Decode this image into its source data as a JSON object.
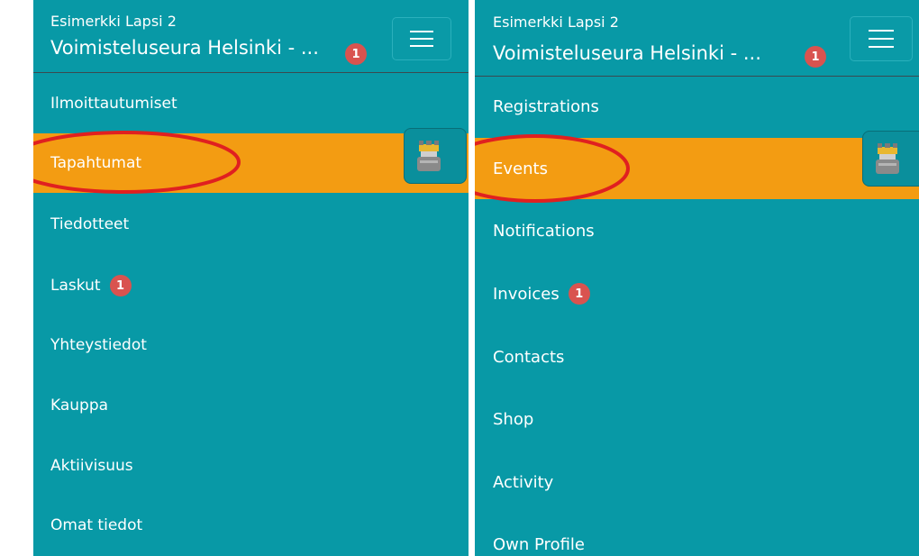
{
  "left": {
    "child_name": "Esimerkki Lapsi 2",
    "club_name": "Voimisteluseura Helsinki - ...",
    "header_badge": "1",
    "menu": [
      {
        "label": "Ilmoittautumiset"
      },
      {
        "label": "Tapahtumat",
        "active": true
      },
      {
        "label": "Tiedotteet"
      },
      {
        "label": "Laskut",
        "badge": "1"
      },
      {
        "label": "Yhteystiedot"
      },
      {
        "label": "Kauppa"
      },
      {
        "label": "Aktiivisuus"
      },
      {
        "label": "Omat tiedot"
      }
    ]
  },
  "right": {
    "child_name": "Esimerkki Lapsi 2",
    "club_name": "Voimisteluseura Helsinki - ...",
    "header_badge": "1",
    "menu": [
      {
        "label": "Registrations"
      },
      {
        "label": "Events",
        "active": true
      },
      {
        "label": "Notifications"
      },
      {
        "label": "Invoices",
        "badge": "1"
      },
      {
        "label": "Contacts"
      },
      {
        "label": "Shop"
      },
      {
        "label": "Activity"
      },
      {
        "label": "Own Profile"
      }
    ]
  },
  "colors": {
    "panel_bg": "#0899a6",
    "active_bg": "#f39c12",
    "badge_bg": "#d9534f",
    "highlight_ring": "#e02020"
  },
  "icons": {
    "menu_toggle": "hamburger-menu-icon",
    "app_tab": "myclub-app-icon"
  }
}
